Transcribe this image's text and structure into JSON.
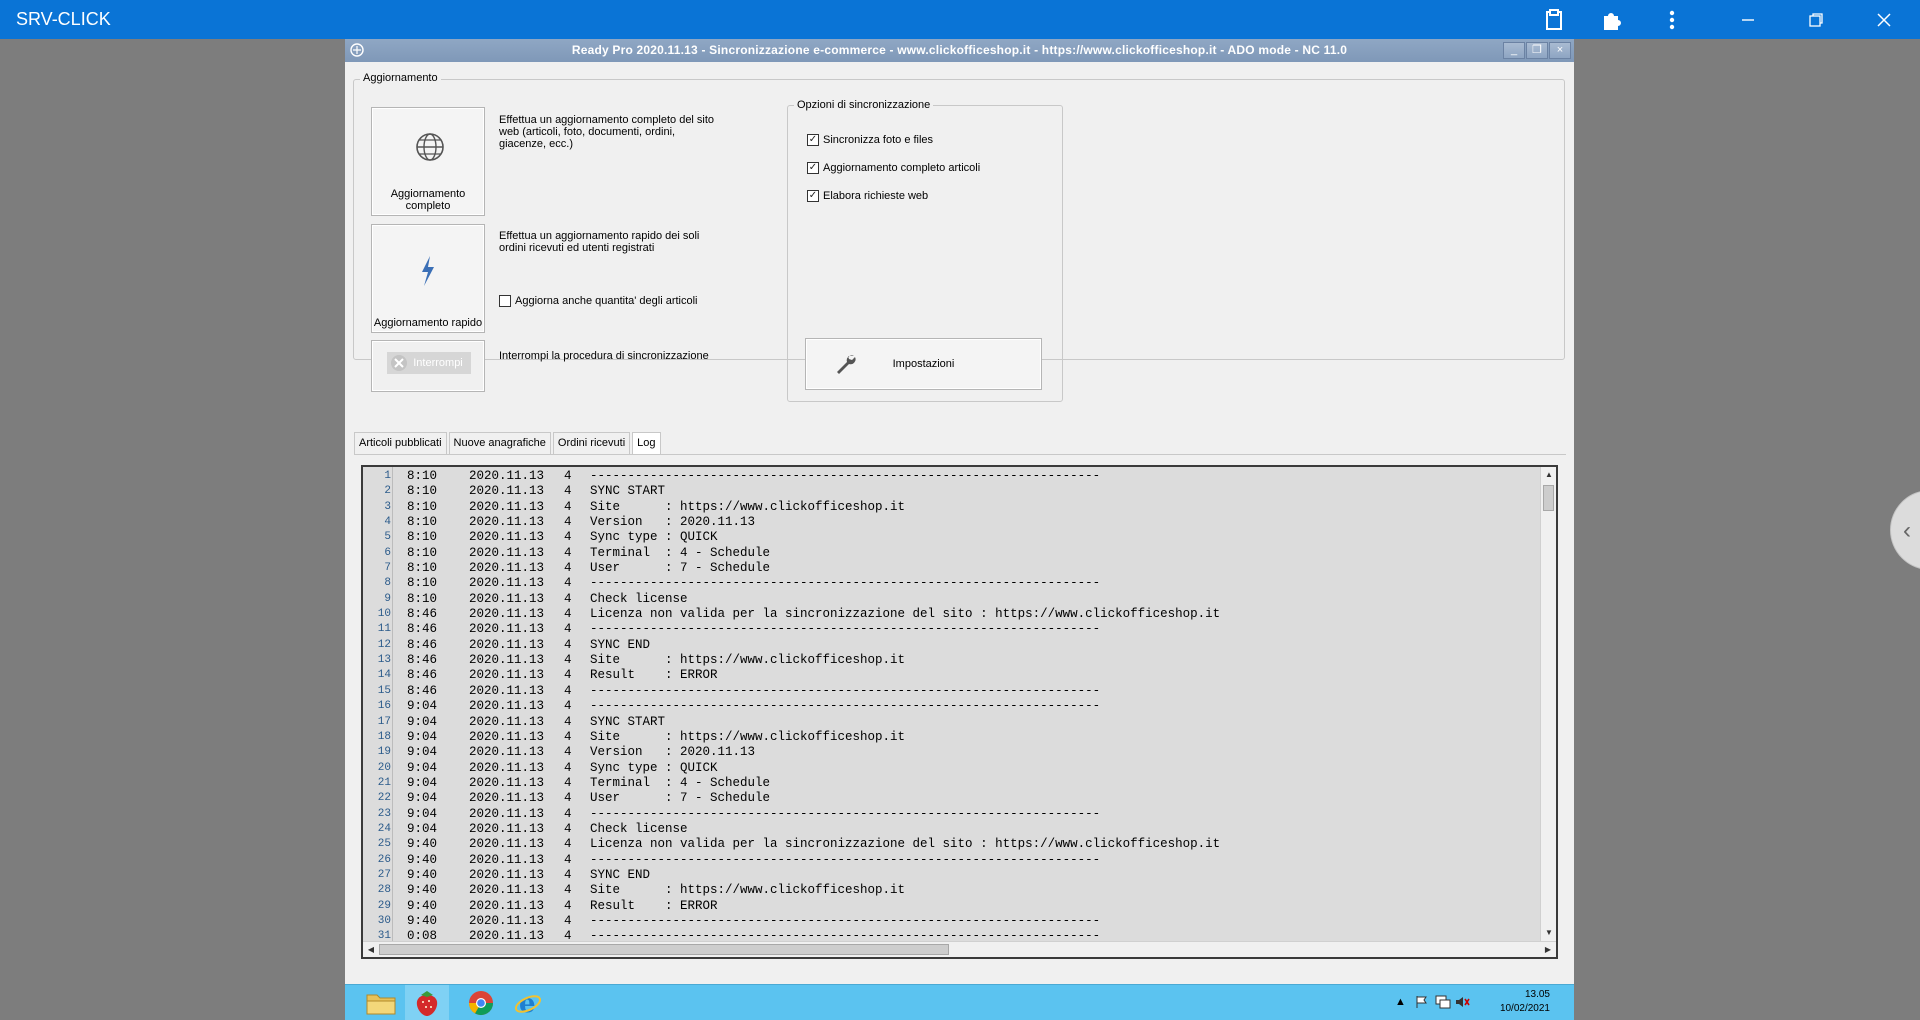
{
  "viewer": {
    "title": "SRV-CLICK",
    "icons": [
      "clipboard-icon",
      "puzzle-icon",
      "more-vertical-icon",
      "minimize-icon",
      "restore-icon",
      "close-icon"
    ]
  },
  "window": {
    "title": "Ready Pro 2020.11.13 - Sincronizzazione e-commerce - www.clickofficeshop.it - https://www.clickofficeshop.it - ADO mode - NC 11.0",
    "minimize_label": "_",
    "restore_label": "❐",
    "close_label": "×"
  },
  "aggiornamento": {
    "group_label": "Aggiornamento",
    "full_button_label": "Aggiornamento completo",
    "full_desc": "Effettua un aggiornamento completo del sito web (articoli, foto, documenti, ordini, giacenze, ecc.)",
    "quick_button_label": "Aggiornamento rapido",
    "quick_desc": "Effettua un aggiornamento rapido dei soli ordini ricevuti ed utenti registrati",
    "quick_checkbox_label": "Aggiorna anche quantita' degli articoli",
    "quick_checkbox_checked": false,
    "stop_button_label": "Interrompi",
    "stop_desc": "Interrompi la procedura di sincronizzazione"
  },
  "opzioni": {
    "group_label": "Opzioni di sincronizzazione",
    "checkboxes": [
      {
        "label": "Sincronizza foto e files",
        "checked": true
      },
      {
        "label": "Aggiornamento completo articoli",
        "checked": true
      },
      {
        "label": "Elabora richieste web",
        "checked": true
      }
    ],
    "settings_button_label": "Impostazioni"
  },
  "tabs": [
    {
      "label": "Articoli pubblicati",
      "active": false
    },
    {
      "label": "Nuove anagrafiche",
      "active": false
    },
    {
      "label": "Ordini ricevuti",
      "active": false
    },
    {
      "label": "Log",
      "active": true
    }
  ],
  "log": {
    "rows": [
      {
        "ln": "1",
        "time": "8:10",
        "date": "2020.11.13",
        "n": "4",
        "msg": "--------------------------------------------------------------------"
      },
      {
        "ln": "2",
        "time": "8:10",
        "date": "2020.11.13",
        "n": "4",
        "msg": "SYNC START"
      },
      {
        "ln": "3",
        "time": "8:10",
        "date": "2020.11.13",
        "n": "4",
        "msg": "Site      : https://www.clickofficeshop.it"
      },
      {
        "ln": "4",
        "time": "8:10",
        "date": "2020.11.13",
        "n": "4",
        "msg": "Version   : 2020.11.13"
      },
      {
        "ln": "5",
        "time": "8:10",
        "date": "2020.11.13",
        "n": "4",
        "msg": "Sync type : QUICK"
      },
      {
        "ln": "6",
        "time": "8:10",
        "date": "2020.11.13",
        "n": "4",
        "msg": "Terminal  : 4 - Schedule"
      },
      {
        "ln": "7",
        "time": "8:10",
        "date": "2020.11.13",
        "n": "4",
        "msg": "User      : 7 - Schedule"
      },
      {
        "ln": "8",
        "time": "8:10",
        "date": "2020.11.13",
        "n": "4",
        "msg": "--------------------------------------------------------------------"
      },
      {
        "ln": "9",
        "time": "8:10",
        "date": "2020.11.13",
        "n": "4",
        "msg": "Check license"
      },
      {
        "ln": "10",
        "time": "8:46",
        "date": "2020.11.13",
        "n": "4",
        "msg": "Licenza non valida per la sincronizzazione del sito : https://www.clickofficeshop.it"
      },
      {
        "ln": "11",
        "time": "8:46",
        "date": "2020.11.13",
        "n": "4",
        "msg": "--------------------------------------------------------------------"
      },
      {
        "ln": "12",
        "time": "8:46",
        "date": "2020.11.13",
        "n": "4",
        "msg": "SYNC END"
      },
      {
        "ln": "13",
        "time": "8:46",
        "date": "2020.11.13",
        "n": "4",
        "msg": "Site      : https://www.clickofficeshop.it"
      },
      {
        "ln": "14",
        "time": "8:46",
        "date": "2020.11.13",
        "n": "4",
        "msg": "Result    : ERROR"
      },
      {
        "ln": "15",
        "time": "8:46",
        "date": "2020.11.13",
        "n": "4",
        "msg": "--------------------------------------------------------------------"
      },
      {
        "ln": "16",
        "time": "9:04",
        "date": "2020.11.13",
        "n": "4",
        "msg": "--------------------------------------------------------------------"
      },
      {
        "ln": "17",
        "time": "9:04",
        "date": "2020.11.13",
        "n": "4",
        "msg": "SYNC START"
      },
      {
        "ln": "18",
        "time": "9:04",
        "date": "2020.11.13",
        "n": "4",
        "msg": "Site      : https://www.clickofficeshop.it"
      },
      {
        "ln": "19",
        "time": "9:04",
        "date": "2020.11.13",
        "n": "4",
        "msg": "Version   : 2020.11.13"
      },
      {
        "ln": "20",
        "time": "9:04",
        "date": "2020.11.13",
        "n": "4",
        "msg": "Sync type : QUICK"
      },
      {
        "ln": "21",
        "time": "9:04",
        "date": "2020.11.13",
        "n": "4",
        "msg": "Terminal  : 4 - Schedule"
      },
      {
        "ln": "22",
        "time": "9:04",
        "date": "2020.11.13",
        "n": "4",
        "msg": "User      : 7 - Schedule"
      },
      {
        "ln": "23",
        "time": "9:04",
        "date": "2020.11.13",
        "n": "4",
        "msg": "--------------------------------------------------------------------"
      },
      {
        "ln": "24",
        "time": "9:04",
        "date": "2020.11.13",
        "n": "4",
        "msg": "Check license"
      },
      {
        "ln": "25",
        "time": "9:40",
        "date": "2020.11.13",
        "n": "4",
        "msg": "Licenza non valida per la sincronizzazione del sito : https://www.clickofficeshop.it"
      },
      {
        "ln": "26",
        "time": "9:40",
        "date": "2020.11.13",
        "n": "4",
        "msg": "--------------------------------------------------------------------"
      },
      {
        "ln": "27",
        "time": "9:40",
        "date": "2020.11.13",
        "n": "4",
        "msg": "SYNC END"
      },
      {
        "ln": "28",
        "time": "9:40",
        "date": "2020.11.13",
        "n": "4",
        "msg": "Site      : https://www.clickofficeshop.it"
      },
      {
        "ln": "29",
        "time": "9:40",
        "date": "2020.11.13",
        "n": "4",
        "msg": "Result    : ERROR"
      },
      {
        "ln": "30",
        "time": "9:40",
        "date": "2020.11.13",
        "n": "4",
        "msg": "--------------------------------------------------------------------"
      },
      {
        "ln": "31",
        "time": "0:08",
        "date": "2020.11.13",
        "n": "4",
        "msg": "--------------------------------------------------------------------"
      }
    ]
  },
  "taskbar": {
    "apps": [
      "file-explorer-icon",
      "strawberry-app-icon",
      "chrome-icon",
      "internet-explorer-icon"
    ],
    "clock_time": "13.05",
    "clock_date": "10/02/2021"
  }
}
